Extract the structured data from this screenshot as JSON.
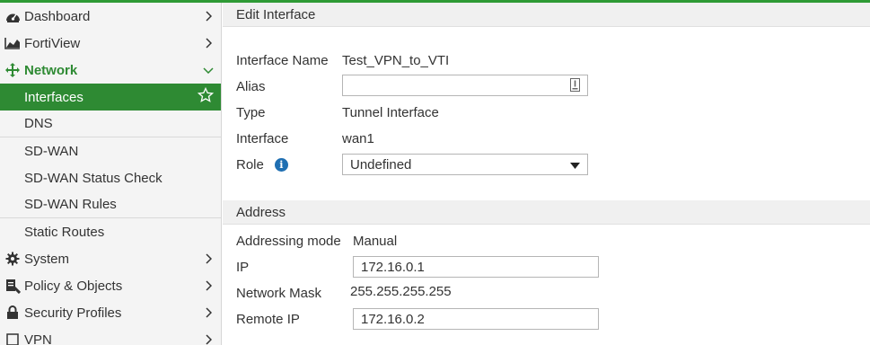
{
  "sidebar": {
    "items": [
      {
        "label": "Dashboard",
        "icon": "dashboard-icon"
      },
      {
        "label": "FortiView",
        "icon": "chart-icon"
      },
      {
        "label": "Network",
        "icon": "network-icon"
      },
      {
        "label": "System",
        "icon": "gear-icon"
      },
      {
        "label": "Policy & Objects",
        "icon": "policy-icon"
      },
      {
        "label": "Security Profiles",
        "icon": "lock-icon"
      },
      {
        "label": "VPN",
        "icon": "vpn-icon"
      }
    ],
    "network_sub": [
      {
        "label": "Interfaces"
      },
      {
        "label": "DNS"
      },
      {
        "label": "SD-WAN"
      },
      {
        "label": "SD-WAN Status Check"
      },
      {
        "label": "SD-WAN Rules"
      },
      {
        "label": "Static Routes"
      }
    ]
  },
  "edit": {
    "header": "Edit Interface",
    "name_label": "Interface Name",
    "name_value": "Test_VPN_to_VTI",
    "alias_label": "Alias",
    "alias_value": "",
    "type_label": "Type",
    "type_value": "Tunnel Interface",
    "interface_label": "Interface",
    "interface_value": "wan1",
    "role_label": "Role",
    "role_value": "Undefined"
  },
  "address": {
    "header": "Address",
    "mode_label": "Addressing mode",
    "mode_value": "Manual",
    "ip_label": "IP",
    "ip_value": "172.16.0.1",
    "mask_label": "Network Mask",
    "mask_value": "255.255.255.255",
    "remote_label": "Remote IP",
    "remote_value": "172.16.0.2"
  },
  "colors": {
    "accent": "#2e8a33",
    "info": "#1f6fb2"
  }
}
